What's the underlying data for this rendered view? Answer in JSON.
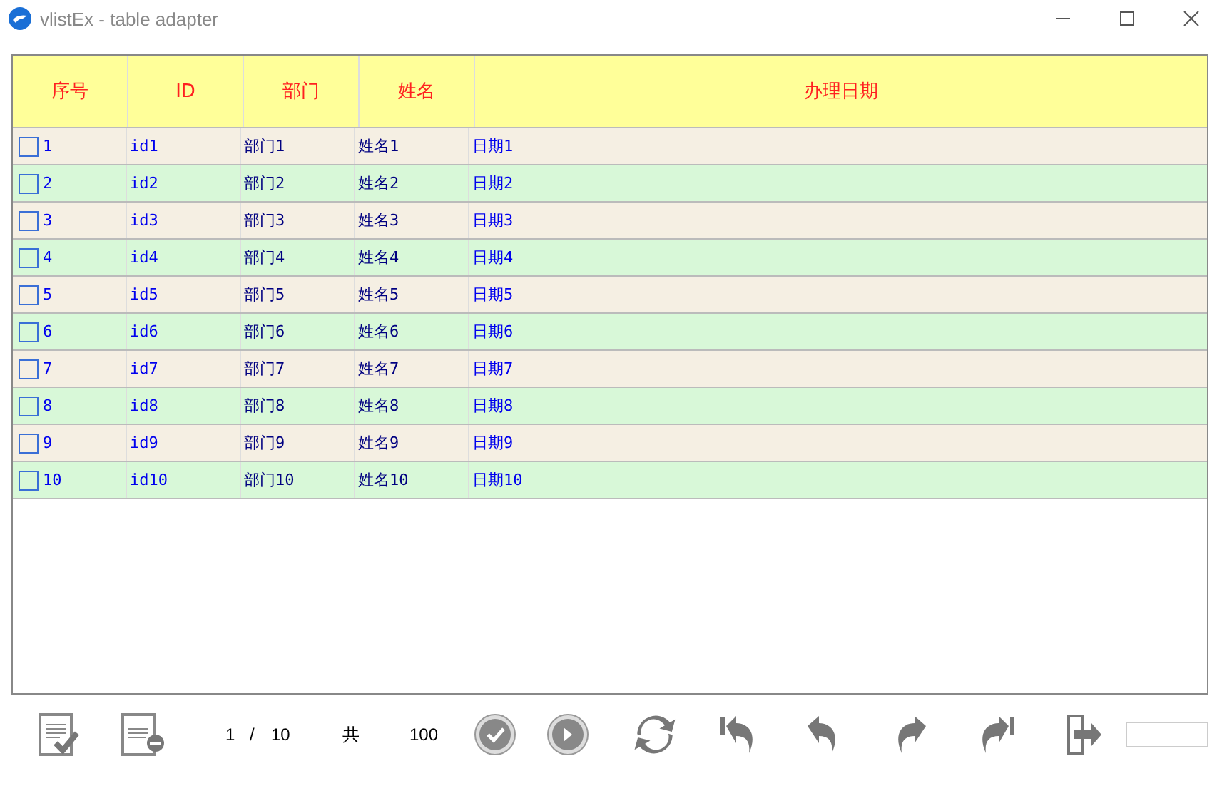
{
  "window": {
    "title": "vlistEx - table adapter"
  },
  "table": {
    "columns": [
      "序号",
      "ID",
      "部门",
      "姓名",
      "办理日期"
    ],
    "rows": [
      {
        "checked": false,
        "cells": [
          "1",
          "id1",
          "部门1",
          "姓名1",
          "日期1"
        ]
      },
      {
        "checked": false,
        "cells": [
          "2",
          "id2",
          "部门2",
          "姓名2",
          "日期2"
        ]
      },
      {
        "checked": false,
        "cells": [
          "3",
          "id3",
          "部门3",
          "姓名3",
          "日期3"
        ]
      },
      {
        "checked": false,
        "cells": [
          "4",
          "id4",
          "部门4",
          "姓名4",
          "日期4"
        ]
      },
      {
        "checked": false,
        "cells": [
          "5",
          "id5",
          "部门5",
          "姓名5",
          "日期5"
        ]
      },
      {
        "checked": false,
        "cells": [
          "6",
          "id6",
          "部门6",
          "姓名6",
          "日期6"
        ]
      },
      {
        "checked": false,
        "cells": [
          "7",
          "id7",
          "部门7",
          "姓名7",
          "日期7"
        ]
      },
      {
        "checked": false,
        "cells": [
          "8",
          "id8",
          "部门8",
          "姓名8",
          "日期8"
        ]
      },
      {
        "checked": false,
        "cells": [
          "9",
          "id9",
          "部门9",
          "姓名9",
          "日期9"
        ]
      },
      {
        "checked": false,
        "cells": [
          "10",
          "id10",
          "部门10",
          "姓名10",
          "日期10"
        ]
      }
    ]
  },
  "pager": {
    "page": "1",
    "separator": "/",
    "pages": "10",
    "total_label": "共",
    "total": "100"
  }
}
